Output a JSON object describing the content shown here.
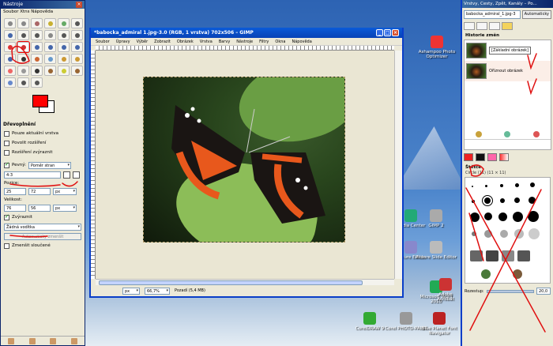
{
  "toolbox": {
    "title": "Nástroje",
    "menu": "Soubor  Xtns  Nápověda",
    "options_title": "Dřevoplnění",
    "options": [
      {
        "label": "Pouze aktuální vrstva",
        "checked": false
      },
      {
        "label": "Povolit rozšíření",
        "checked": false
      },
      {
        "label": "Rozšíření zvýraznit",
        "checked": false
      }
    ],
    "fixed_label": "Pevný:",
    "fixed_value": "Poměr stran",
    "ratio_value": "4:3",
    "pos_label": "Pozice:",
    "pos_x": "25",
    "pos_y": "72",
    "size_label": "Velikost:",
    "size_w": "76",
    "size_h": "56",
    "unit": "px",
    "highlight_label": "Zvýraznit",
    "guides_label": "Žádná vodítka",
    "autoshrink_button": "Automaticky zmenšit",
    "shrink_merged": "Zmenšit sloučené",
    "fg_color": "#ff0000",
    "bg_color": "#ffffff"
  },
  "image_window": {
    "title": "*babocka_admiral 1.jpg-3.0 (RGB, 1 vrstva) 702x506 – GIMP",
    "menu": [
      "Soubor",
      "Úpravy",
      "Výběr",
      "Zobrazit",
      "Obrázek",
      "Vrstva",
      "Barvy",
      "Nástroje",
      "Filtry",
      "Okna",
      "Nápověda"
    ],
    "unit": "px",
    "zoom": "66,7%",
    "status": "Pozadí (5,4 MB)"
  },
  "desktop_icons": [
    {
      "label": "Ashampoo Photo Optimizer",
      "color": "#e33"
    },
    {
      "label": "Media Center",
      "color": "#2a7"
    },
    {
      "label": "GIMP 2",
      "color": "#aaa"
    },
    {
      "label": "Picture Editor",
      "color": "#88c"
    },
    {
      "label": "Picture Slide Editor",
      "color": "#bbb"
    },
    {
      "label": "Microsoft Word 2010",
      "color": "#2a5"
    },
    {
      "label": "CorelDRAW 9",
      "color": "#3a3"
    },
    {
      "label": "Corel PHOTO-PAINT",
      "color": "#999"
    },
    {
      "label": "Blue Planet Font Navigator",
      "color": "#b22"
    },
    {
      "label": "Adobe Acrobat",
      "color": "#c33"
    }
  ],
  "layers_window": {
    "title": "Vrstvy, Cesty, Zpět, Kanály – Po...",
    "image_select": "babocka_admiral_1.jpg-3",
    "auto_button": "Automaticky",
    "history_title": "Historie změn",
    "history": [
      {
        "label": "[Základní obrázek]",
        "selected": false
      },
      {
        "label": "Oříznout obrázek",
        "selected": true
      }
    ],
    "brushes_title": "Štětce",
    "brushes_sub": "Circle (11) (11 × 11)",
    "spacing_label": "Rozestup:",
    "spacing_value": "20,0"
  },
  "annotation_color": "#e01010"
}
